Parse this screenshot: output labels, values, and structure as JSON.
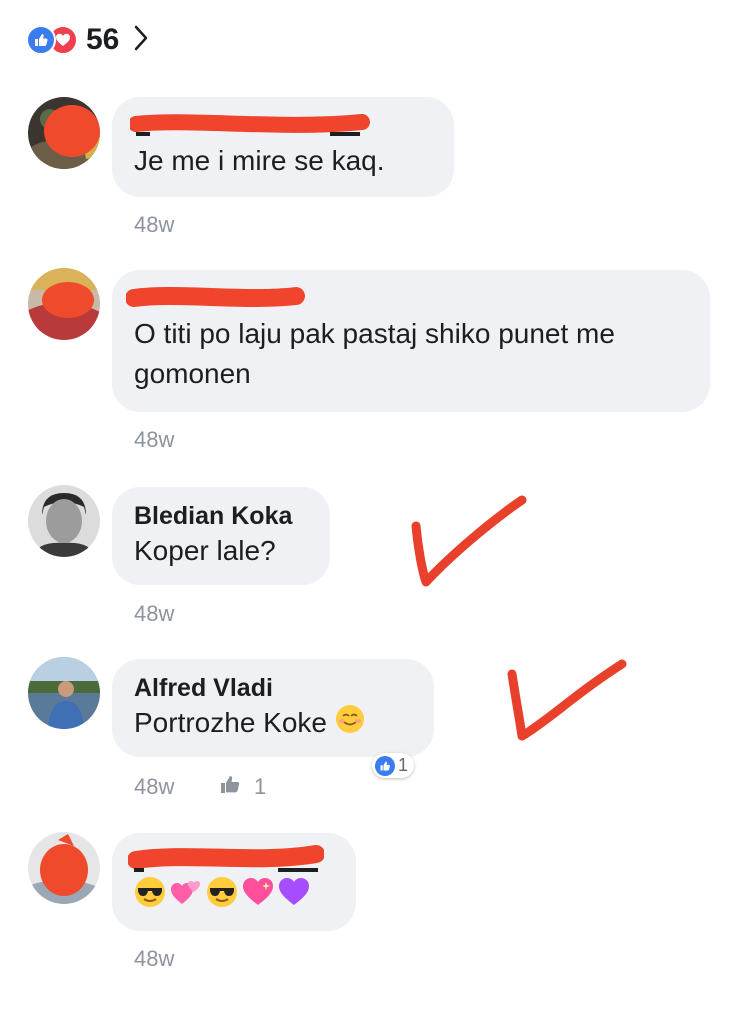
{
  "reactions": {
    "count": "56"
  },
  "comments": [
    {
      "author": "",
      "text": "Je me i mire se kaq.",
      "time": "48w"
    },
    {
      "author": "",
      "text": "O titi po laju pak pastaj shiko punet me gomonen",
      "time": "48w"
    },
    {
      "author": "Bledian Koka",
      "text": "Koper lale?",
      "time": "48w"
    },
    {
      "author": "Alfred Vladi",
      "text": "Portrozhe Koke",
      "time": "48w",
      "like_count": "1",
      "reaction_count": "1"
    },
    {
      "author": "",
      "text": "",
      "time": "48w"
    }
  ],
  "colors": {
    "like_blue": "#3b7cf0",
    "love_red": "#f0404e",
    "annotation_red": "#e8402a",
    "bubble_bg": "#f0f1f4"
  }
}
